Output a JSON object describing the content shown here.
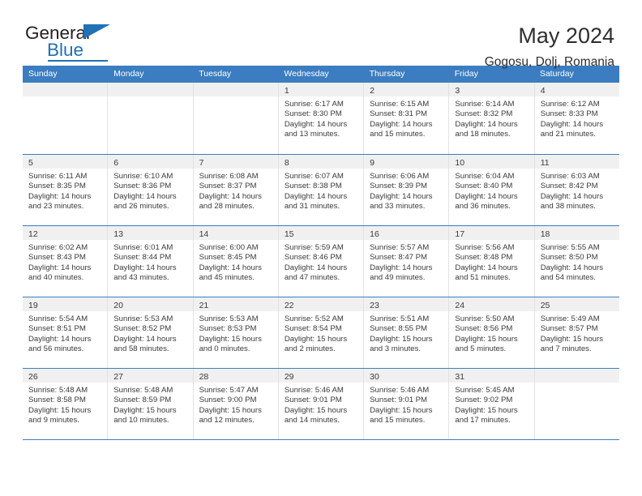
{
  "brand": {
    "name_part1": "General",
    "name_part2": "Blue",
    "accent_color": "#2071b5"
  },
  "header": {
    "title": "May 2024",
    "subtitle": "Gogosu, Dolj, Romania"
  },
  "theme": {
    "header_row_color": "#3b7dc0",
    "day_band_color": "#f0f0f0",
    "text_color": "#3a3a3a"
  },
  "weekdays": [
    "Sunday",
    "Monday",
    "Tuesday",
    "Wednesday",
    "Thursday",
    "Friday",
    "Saturday"
  ],
  "weeks": [
    [
      {
        "day": "",
        "lines": []
      },
      {
        "day": "",
        "lines": []
      },
      {
        "day": "",
        "lines": []
      },
      {
        "day": "1",
        "lines": [
          "Sunrise: 6:17 AM",
          "Sunset: 8:30 PM",
          "Daylight: 14 hours",
          "and 13 minutes."
        ]
      },
      {
        "day": "2",
        "lines": [
          "Sunrise: 6:15 AM",
          "Sunset: 8:31 PM",
          "Daylight: 14 hours",
          "and 15 minutes."
        ]
      },
      {
        "day": "3",
        "lines": [
          "Sunrise: 6:14 AM",
          "Sunset: 8:32 PM",
          "Daylight: 14 hours",
          "and 18 minutes."
        ]
      },
      {
        "day": "4",
        "lines": [
          "Sunrise: 6:12 AM",
          "Sunset: 8:33 PM",
          "Daylight: 14 hours",
          "and 21 minutes."
        ]
      }
    ],
    [
      {
        "day": "5",
        "lines": [
          "Sunrise: 6:11 AM",
          "Sunset: 8:35 PM",
          "Daylight: 14 hours",
          "and 23 minutes."
        ]
      },
      {
        "day": "6",
        "lines": [
          "Sunrise: 6:10 AM",
          "Sunset: 8:36 PM",
          "Daylight: 14 hours",
          "and 26 minutes."
        ]
      },
      {
        "day": "7",
        "lines": [
          "Sunrise: 6:08 AM",
          "Sunset: 8:37 PM",
          "Daylight: 14 hours",
          "and 28 minutes."
        ]
      },
      {
        "day": "8",
        "lines": [
          "Sunrise: 6:07 AM",
          "Sunset: 8:38 PM",
          "Daylight: 14 hours",
          "and 31 minutes."
        ]
      },
      {
        "day": "9",
        "lines": [
          "Sunrise: 6:06 AM",
          "Sunset: 8:39 PM",
          "Daylight: 14 hours",
          "and 33 minutes."
        ]
      },
      {
        "day": "10",
        "lines": [
          "Sunrise: 6:04 AM",
          "Sunset: 8:40 PM",
          "Daylight: 14 hours",
          "and 36 minutes."
        ]
      },
      {
        "day": "11",
        "lines": [
          "Sunrise: 6:03 AM",
          "Sunset: 8:42 PM",
          "Daylight: 14 hours",
          "and 38 minutes."
        ]
      }
    ],
    [
      {
        "day": "12",
        "lines": [
          "Sunrise: 6:02 AM",
          "Sunset: 8:43 PM",
          "Daylight: 14 hours",
          "and 40 minutes."
        ]
      },
      {
        "day": "13",
        "lines": [
          "Sunrise: 6:01 AM",
          "Sunset: 8:44 PM",
          "Daylight: 14 hours",
          "and 43 minutes."
        ]
      },
      {
        "day": "14",
        "lines": [
          "Sunrise: 6:00 AM",
          "Sunset: 8:45 PM",
          "Daylight: 14 hours",
          "and 45 minutes."
        ]
      },
      {
        "day": "15",
        "lines": [
          "Sunrise: 5:59 AM",
          "Sunset: 8:46 PM",
          "Daylight: 14 hours",
          "and 47 minutes."
        ]
      },
      {
        "day": "16",
        "lines": [
          "Sunrise: 5:57 AM",
          "Sunset: 8:47 PM",
          "Daylight: 14 hours",
          "and 49 minutes."
        ]
      },
      {
        "day": "17",
        "lines": [
          "Sunrise: 5:56 AM",
          "Sunset: 8:48 PM",
          "Daylight: 14 hours",
          "and 51 minutes."
        ]
      },
      {
        "day": "18",
        "lines": [
          "Sunrise: 5:55 AM",
          "Sunset: 8:50 PM",
          "Daylight: 14 hours",
          "and 54 minutes."
        ]
      }
    ],
    [
      {
        "day": "19",
        "lines": [
          "Sunrise: 5:54 AM",
          "Sunset: 8:51 PM",
          "Daylight: 14 hours",
          "and 56 minutes."
        ]
      },
      {
        "day": "20",
        "lines": [
          "Sunrise: 5:53 AM",
          "Sunset: 8:52 PM",
          "Daylight: 14 hours",
          "and 58 minutes."
        ]
      },
      {
        "day": "21",
        "lines": [
          "Sunrise: 5:53 AM",
          "Sunset: 8:53 PM",
          "Daylight: 15 hours",
          "and 0 minutes."
        ]
      },
      {
        "day": "22",
        "lines": [
          "Sunrise: 5:52 AM",
          "Sunset: 8:54 PM",
          "Daylight: 15 hours",
          "and 2 minutes."
        ]
      },
      {
        "day": "23",
        "lines": [
          "Sunrise: 5:51 AM",
          "Sunset: 8:55 PM",
          "Daylight: 15 hours",
          "and 3 minutes."
        ]
      },
      {
        "day": "24",
        "lines": [
          "Sunrise: 5:50 AM",
          "Sunset: 8:56 PM",
          "Daylight: 15 hours",
          "and 5 minutes."
        ]
      },
      {
        "day": "25",
        "lines": [
          "Sunrise: 5:49 AM",
          "Sunset: 8:57 PM",
          "Daylight: 15 hours",
          "and 7 minutes."
        ]
      }
    ],
    [
      {
        "day": "26",
        "lines": [
          "Sunrise: 5:48 AM",
          "Sunset: 8:58 PM",
          "Daylight: 15 hours",
          "and 9 minutes."
        ]
      },
      {
        "day": "27",
        "lines": [
          "Sunrise: 5:48 AM",
          "Sunset: 8:59 PM",
          "Daylight: 15 hours",
          "and 10 minutes."
        ]
      },
      {
        "day": "28",
        "lines": [
          "Sunrise: 5:47 AM",
          "Sunset: 9:00 PM",
          "Daylight: 15 hours",
          "and 12 minutes."
        ]
      },
      {
        "day": "29",
        "lines": [
          "Sunrise: 5:46 AM",
          "Sunset: 9:01 PM",
          "Daylight: 15 hours",
          "and 14 minutes."
        ]
      },
      {
        "day": "30",
        "lines": [
          "Sunrise: 5:46 AM",
          "Sunset: 9:01 PM",
          "Daylight: 15 hours",
          "and 15 minutes."
        ]
      },
      {
        "day": "31",
        "lines": [
          "Sunrise: 5:45 AM",
          "Sunset: 9:02 PM",
          "Daylight: 15 hours",
          "and 17 minutes."
        ]
      },
      {
        "day": "",
        "lines": []
      }
    ]
  ]
}
